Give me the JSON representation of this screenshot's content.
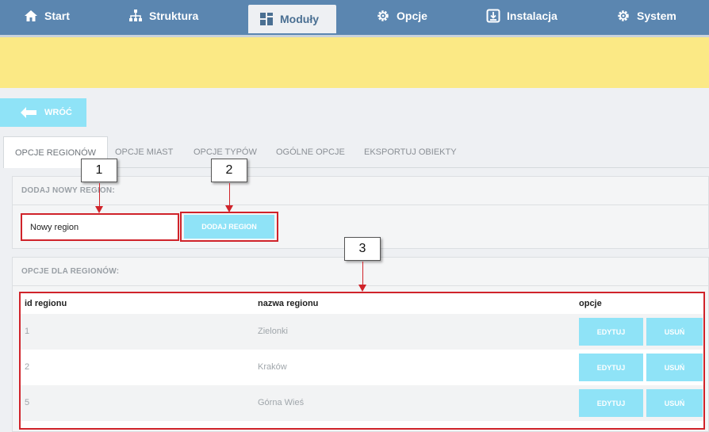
{
  "nav": {
    "items": [
      {
        "label": "Start",
        "icon": "home-icon"
      },
      {
        "label": "Struktura",
        "icon": "sitemap-icon"
      },
      {
        "label": "Moduły",
        "icon": "modules-icon"
      },
      {
        "label": "Opcje",
        "icon": "gear-icon"
      },
      {
        "label": "Instalacja",
        "icon": "install-icon"
      },
      {
        "label": "System",
        "icon": "gear-icon"
      }
    ],
    "active": "Moduły"
  },
  "back_button": {
    "label": "WRÓĆ",
    "icon": "arrow-left-icon"
  },
  "tabs": [
    {
      "label": "OPCJE REGIONÓW"
    },
    {
      "label": "OPCJE MIAST"
    },
    {
      "label": "OPCJE TYPÓW"
    },
    {
      "label": "OGÓLNE OPCJE"
    },
    {
      "label": "EKSPORTUJ OBIEKTY"
    }
  ],
  "add_region": {
    "heading": "DODAJ NOWY REGION:",
    "input_value": "Nowy region",
    "button_label": "DODAJ REGION"
  },
  "regions_panel": {
    "heading": "OPCJE DLA REGIONÓW:",
    "columns": [
      "id regionu",
      "nazwa regionu",
      "opcje"
    ],
    "rows": [
      {
        "id": "1",
        "name": "Zielonki",
        "edit": "EDYTUJ",
        "delete": "USUŃ"
      },
      {
        "id": "2",
        "name": "Kraków",
        "edit": "EDYTUJ",
        "delete": "USUŃ"
      },
      {
        "id": "5",
        "name": "Górna Wieś",
        "edit": "EDYTUJ",
        "delete": "USUŃ"
      }
    ]
  },
  "callouts": [
    "1",
    "2",
    "3"
  ],
  "colors": {
    "nav_bg": "#5b86b0",
    "notice_bg": "#fbe985",
    "accent_button": "#8fe3f7",
    "highlight_red": "#d0232a"
  }
}
